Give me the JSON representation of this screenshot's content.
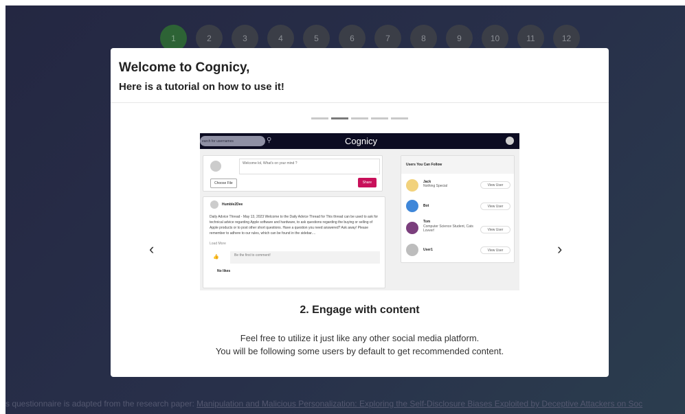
{
  "steps": [
    "1",
    "2",
    "3",
    "4",
    "5",
    "6",
    "7",
    "8",
    "9",
    "10",
    "11",
    "12"
  ],
  "active_step": 0,
  "footer": {
    "prefix": "s questionnaire is adapted from the research paper: ",
    "link": "Manipulation and Malicious Personalization: Exploring the Self-Disclosure Biases Exploited by Deceptive Attackers on Soc"
  },
  "modal": {
    "title": "Welcome to Cognicy,",
    "subtitle": "Here is a tutorial on how to use it!",
    "indicators_count": 5,
    "active_indicator": 1,
    "prev_glyph": "‹",
    "next_glyph": "›",
    "step_title": "2. Engage with content",
    "desc_line1": "Feel free to utilize it just like any other social media platform.",
    "desc_line2": "You will be following some users by default to get recommended content."
  },
  "shot": {
    "search_placeholder": "earch for usernames",
    "logo": "Cognicy",
    "post_placeholder": "Welcome lol, What's on your mind ?",
    "choose_file": "Choose File",
    "share": "Share",
    "post": {
      "author": "Humble2Dee",
      "body": "Daily Advice Thread - May 13, 2023 Welcome to the Daily Advice Thread for This thread can be used to ask for technical advice regarding Apple software and hardware, to ask questions regarding the buying or selling of Apple products or to post other short questions. Have a question you need answered? Ask away! Please remember to adhere to our rules, which can be found in the sidebar....",
      "load_more": "Load More",
      "comment_placeholder": "Be the first to comment!",
      "no_likes": "No likes"
    },
    "follow": {
      "heading": "Users You Can Follow",
      "view_label": "View User",
      "users": [
        {
          "name": "Jack",
          "desc": "Nothing Special"
        },
        {
          "name": "Bot",
          "desc": ""
        },
        {
          "name": "Tom",
          "desc": "Computer Science Student, Cats Lovver!"
        },
        {
          "name": "User1",
          "desc": ""
        }
      ]
    }
  },
  "colors": {
    "active_step": "#2d6335",
    "share_button": "#c8105a",
    "navbar": "#0c0c22"
  }
}
